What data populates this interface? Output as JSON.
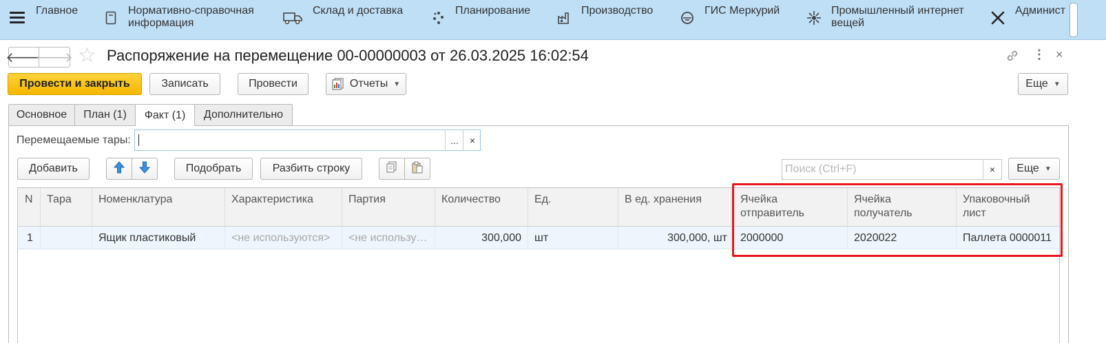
{
  "nav": {
    "items": [
      {
        "label": "Главное",
        "icon": "none"
      },
      {
        "label": "Нормативно-справочная\nинформация",
        "icon": "book-icon"
      },
      {
        "label": "Склад и доставка",
        "icon": "truck-icon"
      },
      {
        "label": "Планирование",
        "icon": "dots-icon"
      },
      {
        "label": "Производство",
        "icon": "factory-icon"
      },
      {
        "label": "ГИС Меркурий",
        "icon": "mercury-icon"
      },
      {
        "label": "Промышленный интернет\nвещей",
        "icon": "iot-icon"
      },
      {
        "label": "Админист",
        "icon": "tools-icon"
      }
    ]
  },
  "document": {
    "title": "Распоряжение на перемещение 00-00000003 от 26.03.2025 16:02:54"
  },
  "toolbar": {
    "post_close": "Провести и закрыть",
    "save": "Записать",
    "post": "Провести",
    "reports": "Отчеты",
    "more": "Еще"
  },
  "tabs": [
    {
      "label": "Основное"
    },
    {
      "label": "План (1)"
    },
    {
      "label": "Факт (1)",
      "active": true
    },
    {
      "label": "Дополнительно"
    }
  ],
  "containers_field": {
    "label": "Перемещаемые тары:",
    "value": "",
    "dots": "...",
    "clear": "×"
  },
  "table_toolbar": {
    "add": "Добавить",
    "pick": "Подобрать",
    "split": "Разбить строку",
    "search_placeholder": "Поиск (Ctrl+F)",
    "clear": "×",
    "more": "Еще"
  },
  "table": {
    "columns": [
      "N",
      "Тара",
      "Номенклатура",
      "Характеристика",
      "Партия",
      "Количество",
      "Ед.",
      "В ед. хранения",
      "Ячейка\nотправитель",
      "Ячейка\nполучатель",
      "Упаковочный\nлист"
    ],
    "rows": [
      [
        "1",
        "",
        "Ящик пластиковый",
        "<не используются>",
        "<не используются>",
        "300,000",
        "шт",
        "300,000, шт",
        "2000000",
        "2020022",
        "Паллета 0000011"
      ]
    ]
  },
  "colors": {
    "nav_bg": "#bfdff7",
    "primary_button": "#f5b700",
    "highlight": "#e8161c",
    "selected_row": "#eef5fc"
  }
}
